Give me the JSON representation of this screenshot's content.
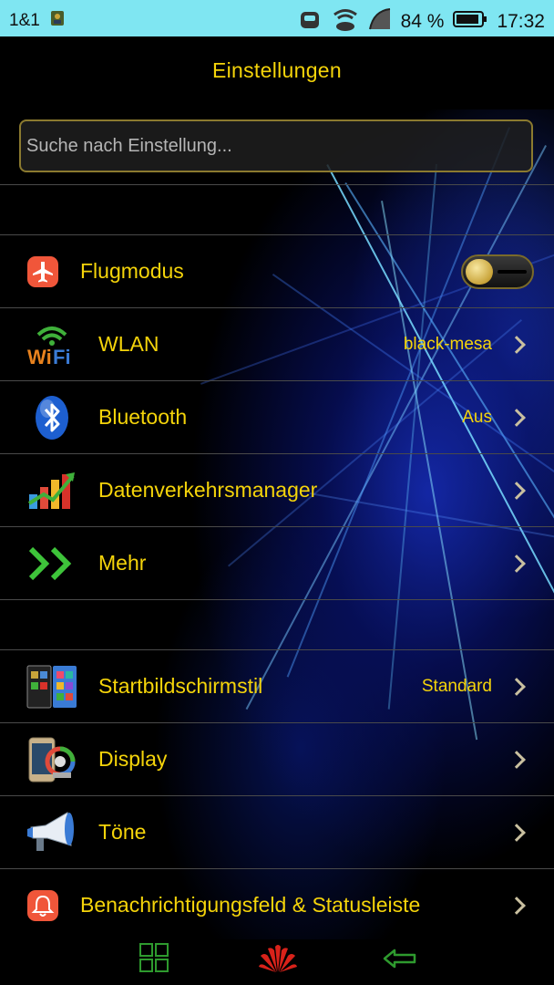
{
  "statusbar": {
    "carrier": "1&1",
    "battery_percent": "84 %",
    "time": "17:32"
  },
  "title": "Einstellungen",
  "search": {
    "placeholder": "Suche nach Einstellung..."
  },
  "items": [
    {
      "label": "Flugmodus",
      "icon": "airplane-icon",
      "toggle_on": false
    },
    {
      "label": "WLAN",
      "value": "black-mesa",
      "icon": "wifi-icon"
    },
    {
      "label": "Bluetooth",
      "value": "Aus",
      "icon": "bluetooth-icon"
    },
    {
      "label": "Datenverkehrsmanager",
      "icon": "chart-icon"
    },
    {
      "label": "Mehr",
      "icon": "double-chevron-icon"
    },
    {
      "label": "Startbildschirmstil",
      "value": "Standard",
      "icon": "home-screen-icon"
    },
    {
      "label": "Display",
      "icon": "display-icon"
    },
    {
      "label": "Töne",
      "icon": "megaphone-icon"
    },
    {
      "label": "Benachrichtigungsfeld & Statusleiste",
      "icon": "bell-icon"
    }
  ],
  "navbar": {
    "icons": [
      "grid-icon",
      "huawei-logo-icon",
      "back-arrow-icon"
    ]
  },
  "colors": {
    "accent": "#f5d40a",
    "statusbar": "#7fe6f2",
    "divider": "#4a4a4a"
  }
}
